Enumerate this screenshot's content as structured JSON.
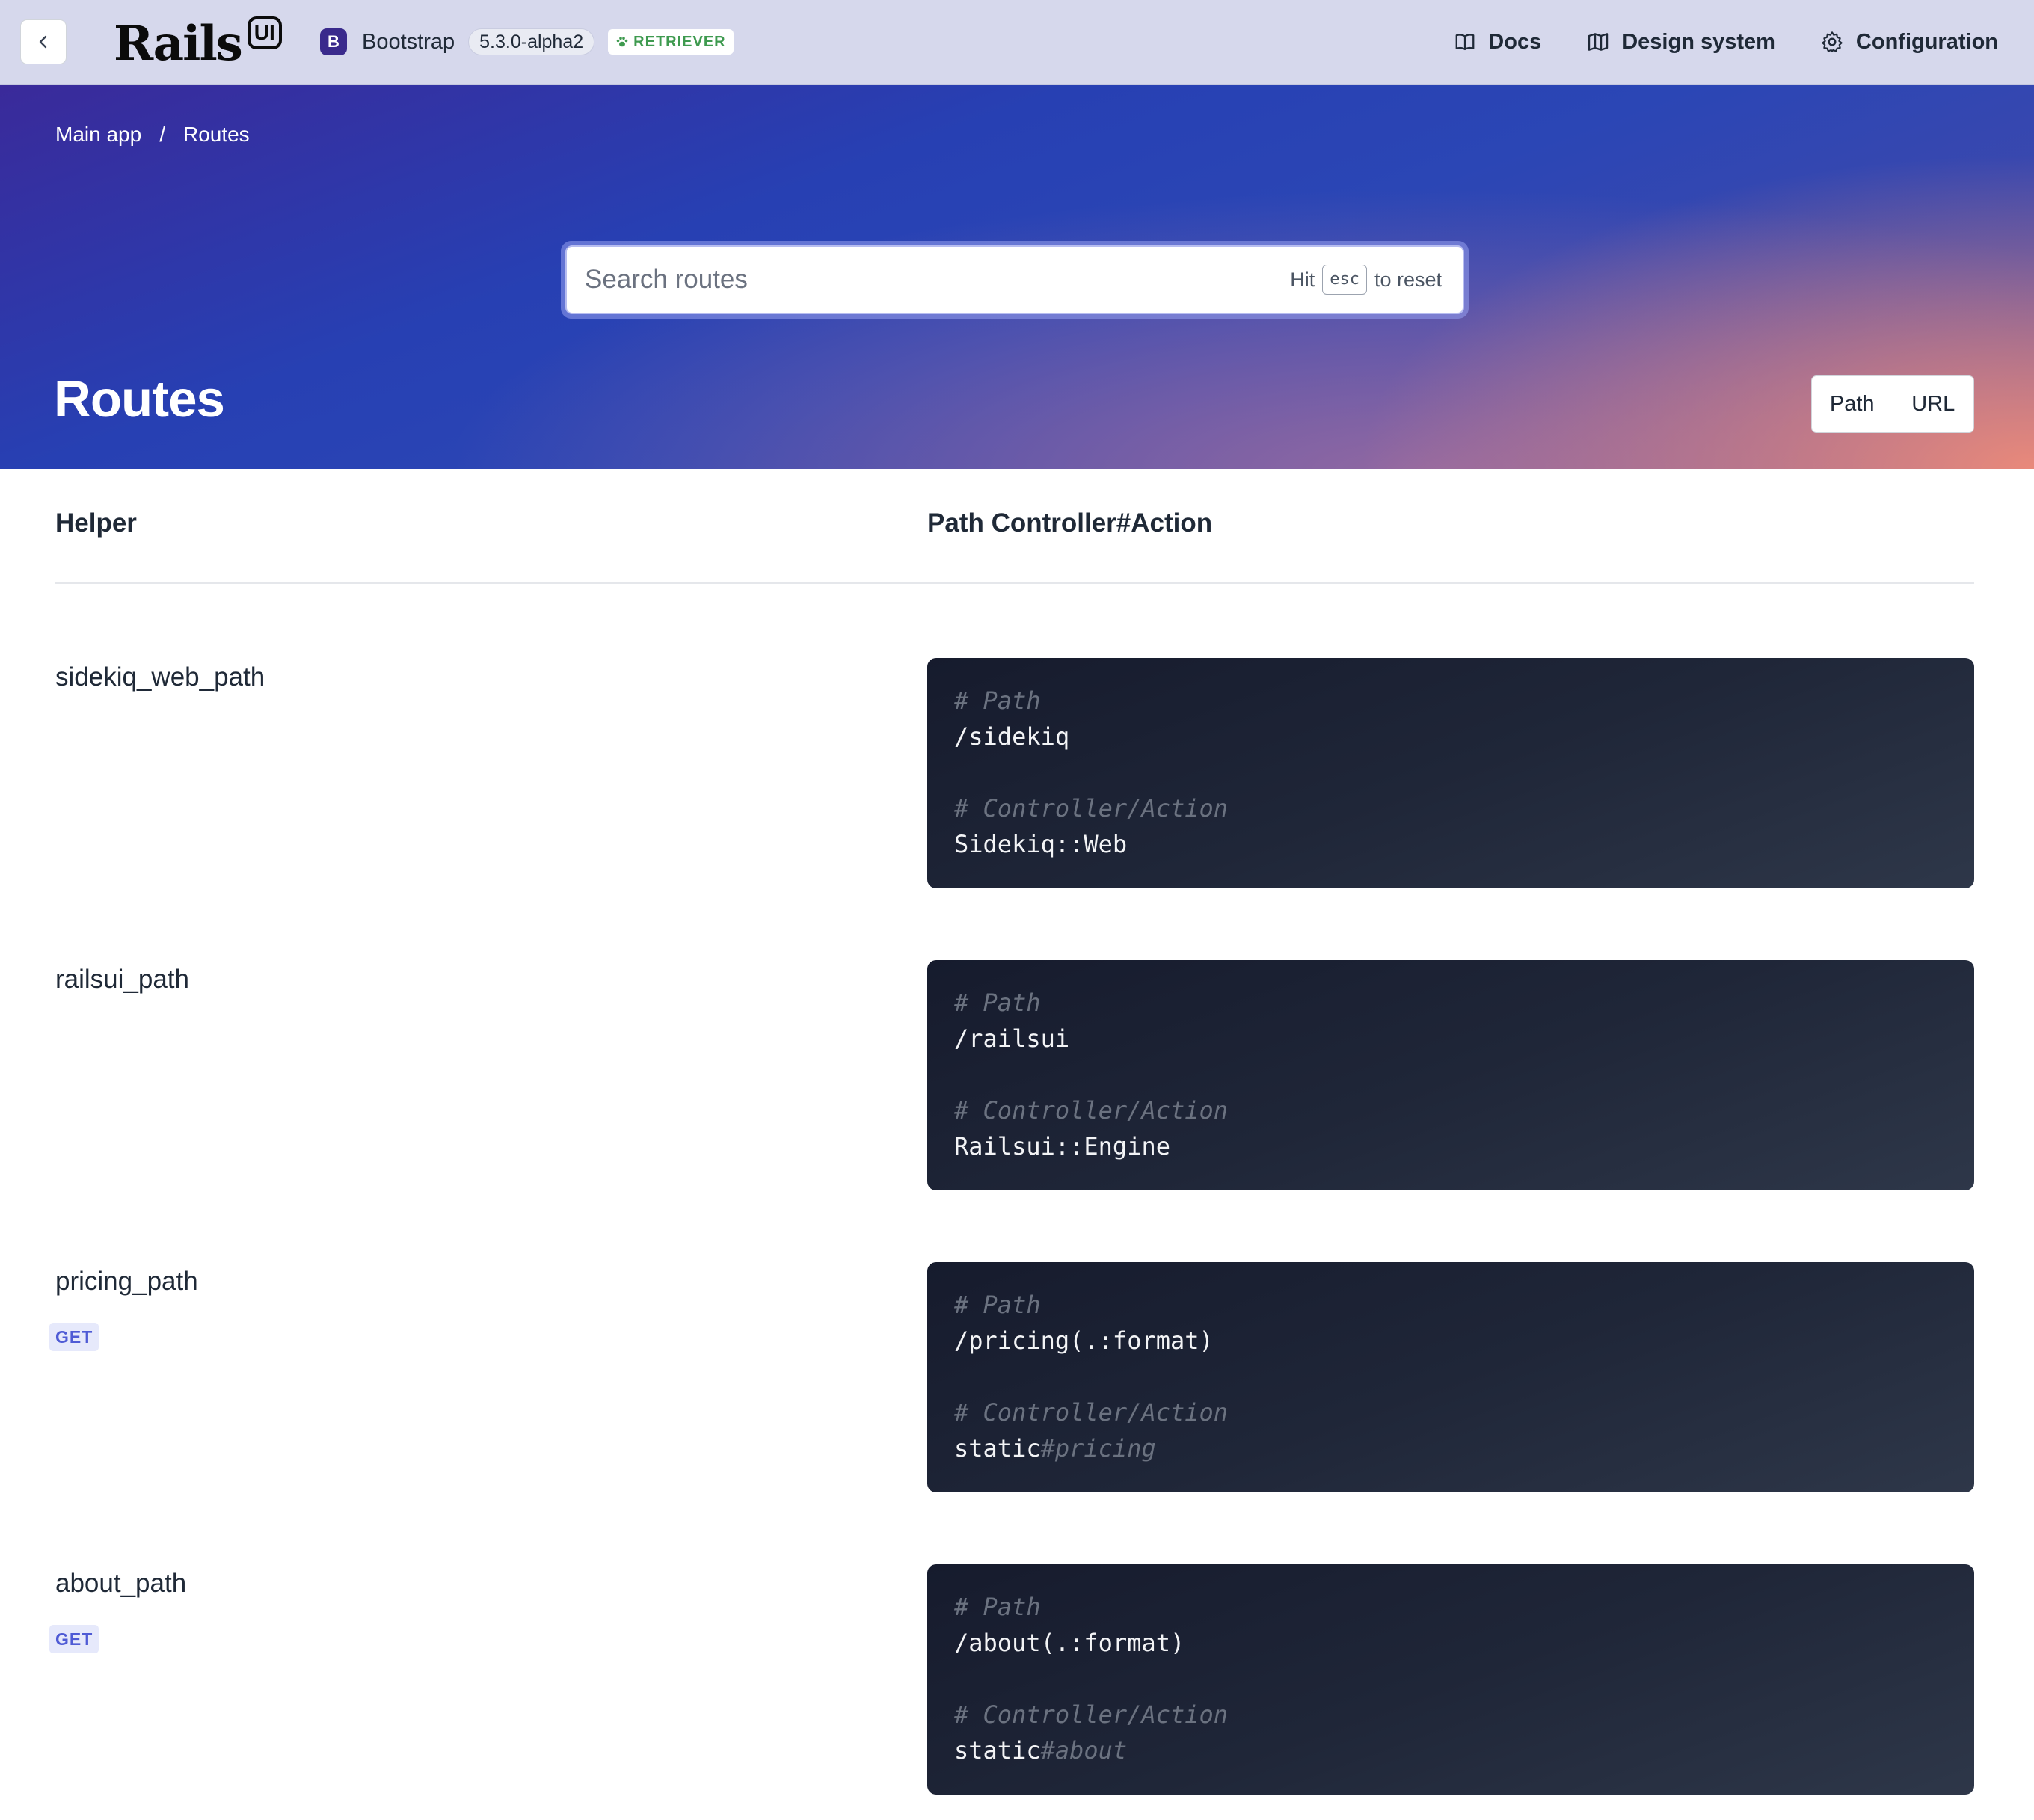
{
  "topnav": {
    "back_icon": "chevron-left-icon",
    "logo_word": "Rails",
    "logo_badge": "UI",
    "framework_icon_letter": "B",
    "framework_name": "Bootstrap",
    "framework_version": "5.3.0-alpha2",
    "theme_badge": "RETRIEVER",
    "theme_badge_color": "#3e9a4f",
    "links": [
      {
        "label": "Docs",
        "icon": "book-icon"
      },
      {
        "label": "Design system",
        "icon": "map-icon"
      },
      {
        "label": "Configuration",
        "icon": "gear-icon"
      }
    ]
  },
  "breadcrumb": {
    "items": [
      "Main app",
      "Routes"
    ],
    "separator": "/"
  },
  "search": {
    "placeholder": "Search routes",
    "hint_prefix": "Hit",
    "hint_key": "esc",
    "hint_suffix": "to reset"
  },
  "page": {
    "title": "Routes",
    "view_toggle": [
      "Path",
      "URL"
    ]
  },
  "table": {
    "headers": [
      "Helper",
      "Path Controller#Action"
    ],
    "path_comment": "# Path",
    "controller_comment": "# Controller/Action",
    "rows": [
      {
        "helper": "sidekiq_web_path",
        "method": "",
        "path": "/sidekiq",
        "controller": "Sidekiq::Web",
        "action": ""
      },
      {
        "helper": "railsui_path",
        "method": "",
        "path": "/railsui",
        "controller": "Railsui::Engine",
        "action": ""
      },
      {
        "helper": "pricing_path",
        "method": "GET",
        "path": "/pricing(.:format)",
        "controller": "static",
        "action": "#pricing"
      },
      {
        "helper": "about_path",
        "method": "GET",
        "path": "/about(.:format)",
        "controller": "static",
        "action": "#about"
      }
    ]
  },
  "colors": {
    "nav_bg": "#d6d8ec",
    "hero_start": "#3a2a9a",
    "hero_mid": "#2740b3",
    "hero_end": "#f08c78",
    "code_bg": "#1f2638",
    "method_badge_text": "#4f5bd5"
  }
}
